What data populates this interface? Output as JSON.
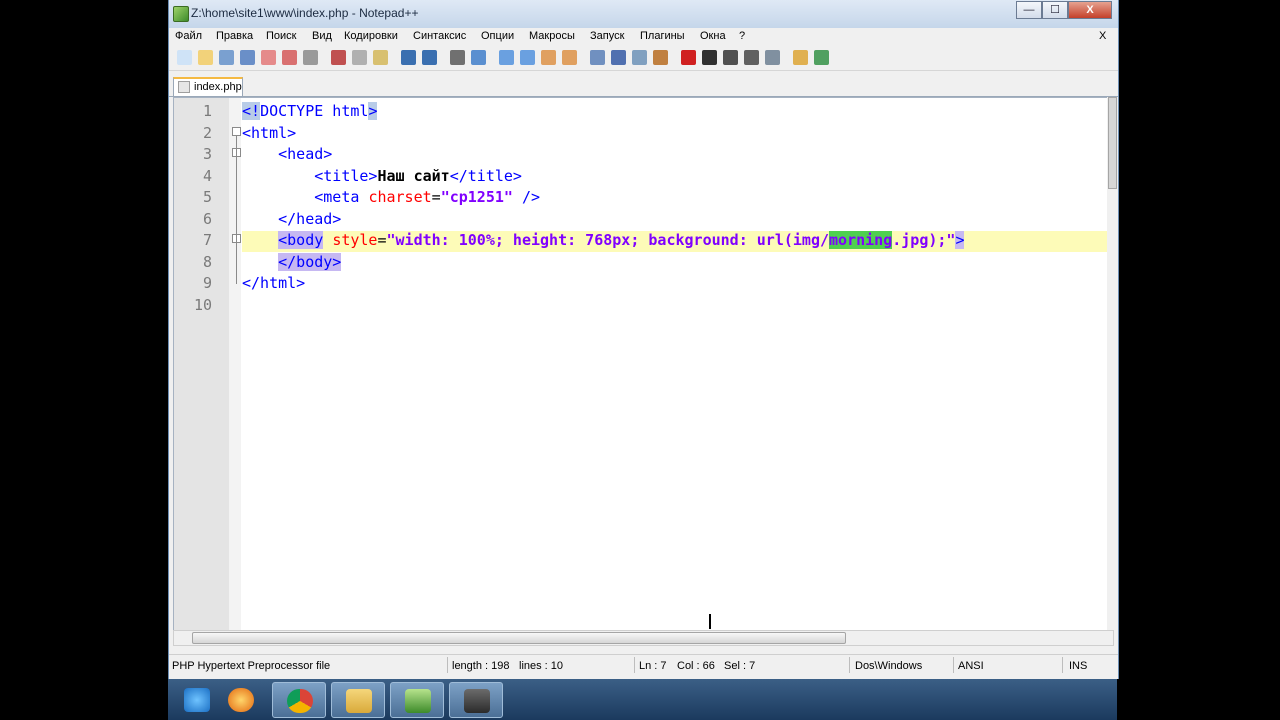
{
  "window": {
    "title": "Z:\\home\\site1\\www\\index.php - Notepad++",
    "btn_min": "—",
    "btn_max": "☐",
    "btn_close": "X",
    "menu_close": "X"
  },
  "menu": [
    "Файл",
    "Правка",
    "Поиск",
    "Вид",
    "Кодировки",
    "Синтаксис",
    "Опции",
    "Макросы",
    "Запуск",
    "Плагины",
    "Окна",
    "?"
  ],
  "toolbar_icons": [
    "new-file-icon",
    "open-file-icon",
    "save-icon",
    "save-all-icon",
    "close-icon",
    "close-all-icon",
    "print-icon",
    "cut-icon",
    "copy-icon",
    "paste-icon",
    "undo-icon",
    "redo-icon",
    "find-icon",
    "replace-icon",
    "zoom-in-icon",
    "zoom-out-icon",
    "sync-vertical-icon",
    "sync-horizontal-icon",
    "word-wrap-icon",
    "show-all-chars-icon",
    "indent-guide-icon",
    "fold-icon",
    "record-macro-icon",
    "stop-macro-icon",
    "play-macro-icon",
    "play-multiple-icon",
    "save-macro-icon",
    "launch-icon",
    "spellcheck-icon"
  ],
  "tab": {
    "label": "index.php"
  },
  "lines": [
    {
      "num": "1",
      "tokens": [
        {
          "t": "<!",
          "c": "tag sel-box"
        },
        {
          "t": "DOCTYPE html",
          "c": "tag"
        },
        {
          "t": ">",
          "c": "tag sel-box"
        }
      ]
    },
    {
      "num": "2",
      "tokens": [
        {
          "t": "<html>",
          "c": "tag"
        }
      ]
    },
    {
      "num": "3",
      "tokens": [
        {
          "t": "    ",
          "c": "plain"
        },
        {
          "t": "<head>",
          "c": "tag"
        }
      ]
    },
    {
      "num": "4",
      "tokens": [
        {
          "t": "        ",
          "c": "plain"
        },
        {
          "t": "<title>",
          "c": "tag"
        },
        {
          "t": "Наш сайт",
          "c": "txt"
        },
        {
          "t": "</title>",
          "c": "tag"
        }
      ]
    },
    {
      "num": "5",
      "tokens": [
        {
          "t": "        ",
          "c": "plain"
        },
        {
          "t": "<meta ",
          "c": "tag"
        },
        {
          "t": "charset",
          "c": "attr"
        },
        {
          "t": "=",
          "c": "plain"
        },
        {
          "t": "\"cp1251\"",
          "c": "val"
        },
        {
          "t": " />",
          "c": "tag"
        }
      ]
    },
    {
      "num": "6",
      "tokens": [
        {
          "t": "    ",
          "c": "plain"
        },
        {
          "t": "</head>",
          "c": "tag"
        }
      ]
    },
    {
      "num": "7",
      "tokens": [
        {
          "t": "    ",
          "c": "plain"
        },
        {
          "t": "<body",
          "c": "tag sel-tag"
        },
        {
          "t": " ",
          "c": "plain"
        },
        {
          "t": "style",
          "c": "attr"
        },
        {
          "t": "=",
          "c": "plain"
        },
        {
          "t": "\"width: 100%; height: 768px; background: url(img/",
          "c": "val"
        },
        {
          "t": "morning",
          "c": "val green"
        },
        {
          "t": ".jpg);\"",
          "c": "val"
        },
        {
          "t": ">",
          "c": "tag sel-tag"
        }
      ]
    },
    {
      "num": "8",
      "tokens": [
        {
          "t": "    ",
          "c": "plain"
        },
        {
          "t": "</body>",
          "c": "tag sel-tag"
        }
      ]
    },
    {
      "num": "9",
      "tokens": [
        {
          "t": "</html>",
          "c": "tag"
        }
      ]
    },
    {
      "num": "10",
      "tokens": []
    }
  ],
  "status": {
    "filetype": "PHP Hypertext Preprocessor file",
    "length": "length : 198",
    "lines": "lines : 10",
    "ln": "Ln : 7",
    "col": "Col : 66",
    "sel": "Sel : 7",
    "eol": "Dos\\Windows",
    "encoding": "ANSI",
    "mode": "INS"
  },
  "taskbar": [
    "ie-icon",
    "firefox-icon",
    "chrome-icon",
    "explorer-icon",
    "notepadpp-icon",
    "app-icon"
  ],
  "colors": {
    "accent": "#f4b942",
    "tag": "#0000ff",
    "attr": "#ff0000",
    "value": "#8000ff",
    "current_line": "#fdfbb8"
  }
}
